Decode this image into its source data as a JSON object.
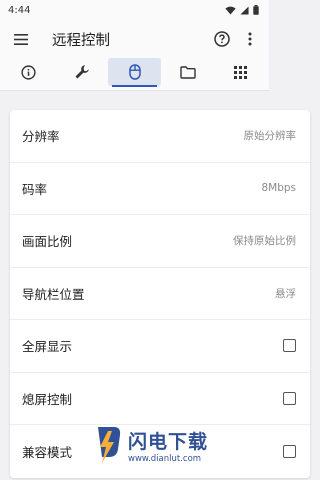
{
  "status": {
    "time": "4:44"
  },
  "appbar": {
    "title": "远程控制"
  },
  "tabs": [
    {
      "icon": "info-icon"
    },
    {
      "icon": "wrench-icon"
    },
    {
      "icon": "mouse-icon",
      "active": true
    },
    {
      "icon": "folder-icon"
    },
    {
      "icon": "grid-icon"
    }
  ],
  "settings": [
    {
      "label": "分辨率",
      "value": "原始分辨率"
    },
    {
      "label": "码率",
      "value": "8Mbps"
    },
    {
      "label": "画面比例",
      "value": "保持原始比例"
    },
    {
      "label": "导航栏位置",
      "value": "悬浮"
    },
    {
      "label": "全屏显示",
      "checked": false
    },
    {
      "label": "熄屏控制",
      "checked": false
    },
    {
      "label": "兼容模式",
      "checked": false
    }
  ],
  "watermark": {
    "brand": "闪电下载",
    "url": "www.dianlut.com"
  },
  "colors": {
    "accent": "#2f58b8",
    "active_tab_bg": "#dde3ef"
  }
}
